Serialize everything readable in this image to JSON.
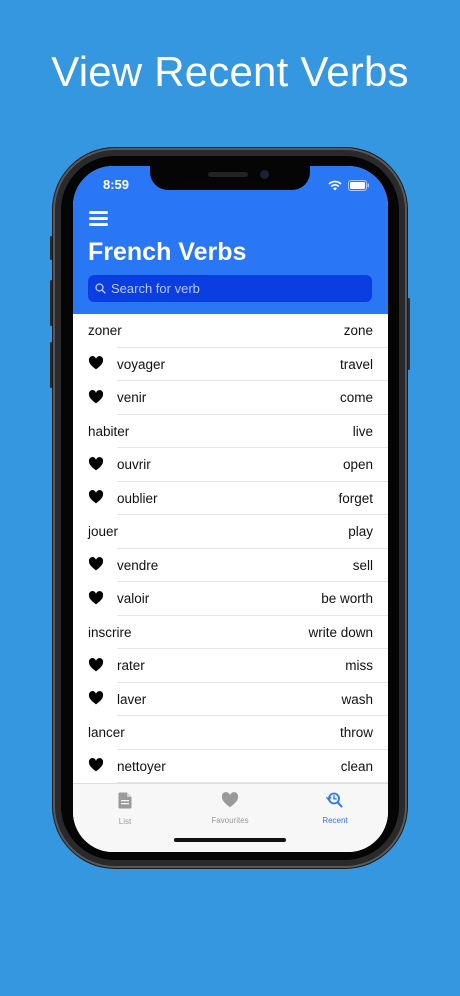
{
  "headline": "View Recent Verbs",
  "status_bar": {
    "time": "8:59"
  },
  "header": {
    "title": "French Verbs"
  },
  "search": {
    "placeholder": "Search for verb"
  },
  "verbs": [
    {
      "french": "zoner",
      "english": "zone",
      "favourite": false
    },
    {
      "french": "voyager",
      "english": "travel",
      "favourite": true
    },
    {
      "french": "venir",
      "english": "come",
      "favourite": true
    },
    {
      "french": "habiter",
      "english": "live",
      "favourite": false
    },
    {
      "french": "ouvrir",
      "english": "open",
      "favourite": true
    },
    {
      "french": "oublier",
      "english": "forget",
      "favourite": true
    },
    {
      "french": "jouer",
      "english": "play",
      "favourite": false
    },
    {
      "french": "vendre",
      "english": "sell",
      "favourite": true
    },
    {
      "french": "valoir",
      "english": "be worth",
      "favourite": true
    },
    {
      "french": "inscrire",
      "english": "write down",
      "favourite": false
    },
    {
      "french": "rater",
      "english": "miss",
      "favourite": true
    },
    {
      "french": "laver",
      "english": "wash",
      "favourite": true
    },
    {
      "french": "lancer",
      "english": "throw",
      "favourite": false
    },
    {
      "french": "nettoyer",
      "english": "clean",
      "favourite": true
    }
  ],
  "tabs": [
    {
      "label": "List",
      "icon": "document-icon",
      "active": false
    },
    {
      "label": "Favourites",
      "icon": "heart-icon",
      "active": false
    },
    {
      "label": "Recent",
      "icon": "search-recent-icon",
      "active": true
    }
  ],
  "colors": {
    "background": "#3597df",
    "header": "#2a77f6",
    "search_field": "#0a3ee0",
    "active_tab": "#2a77f6",
    "inactive_tab": "#9a9a9a"
  }
}
